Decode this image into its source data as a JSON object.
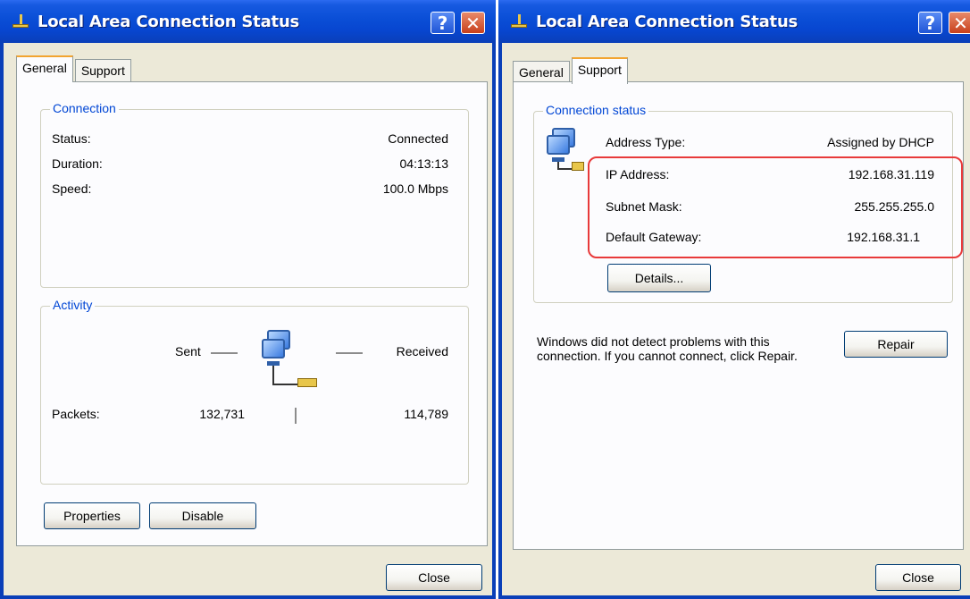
{
  "left": {
    "title": "Local Area Connection Status",
    "help_glyph": "?",
    "close_glyph": "✕",
    "tabs": [
      {
        "label": "General",
        "active": true
      },
      {
        "label": "Support",
        "active": false
      }
    ],
    "connection": {
      "group_title": "Connection",
      "rows": [
        {
          "label": "Status:",
          "value": "Connected"
        },
        {
          "label": "Duration:",
          "value": "04:13:13"
        },
        {
          "label": "Speed:",
          "value": "100.0 Mbps"
        }
      ]
    },
    "activity": {
      "group_title": "Activity",
      "sent_label": "Sent",
      "received_label": "Received",
      "packets_label": "Packets:",
      "packets_sent": "132,731",
      "packets_received": "114,789"
    },
    "buttons": {
      "properties": "Properties",
      "disable": "Disable",
      "close": "Close"
    }
  },
  "right": {
    "title": "Local Area Connection Status",
    "help_glyph": "?",
    "close_glyph": "✕",
    "tabs": [
      {
        "label": "General",
        "active": false
      },
      {
        "label": "Support",
        "active": true
      }
    ],
    "connection_status": {
      "group_title": "Connection status",
      "rows": [
        {
          "label": "Address Type:",
          "value": "Assigned by DHCP"
        },
        {
          "label": "IP Address:",
          "value": "192.168.31.119"
        },
        {
          "label": "Subnet Mask:",
          "value": "255.255.255.0"
        },
        {
          "label": "Default Gateway:",
          "value": "192.168.31.1"
        }
      ],
      "details_button": "Details..."
    },
    "message": "Windows did not detect problems with this connection. If you cannot connect, click Repair.",
    "buttons": {
      "repair": "Repair",
      "close": "Close"
    }
  },
  "colors": {
    "title_bar": "#0a4ed6",
    "group_title": "#0046d5",
    "highlight": "#e83a3a",
    "tab_accent": "#f2a431"
  }
}
